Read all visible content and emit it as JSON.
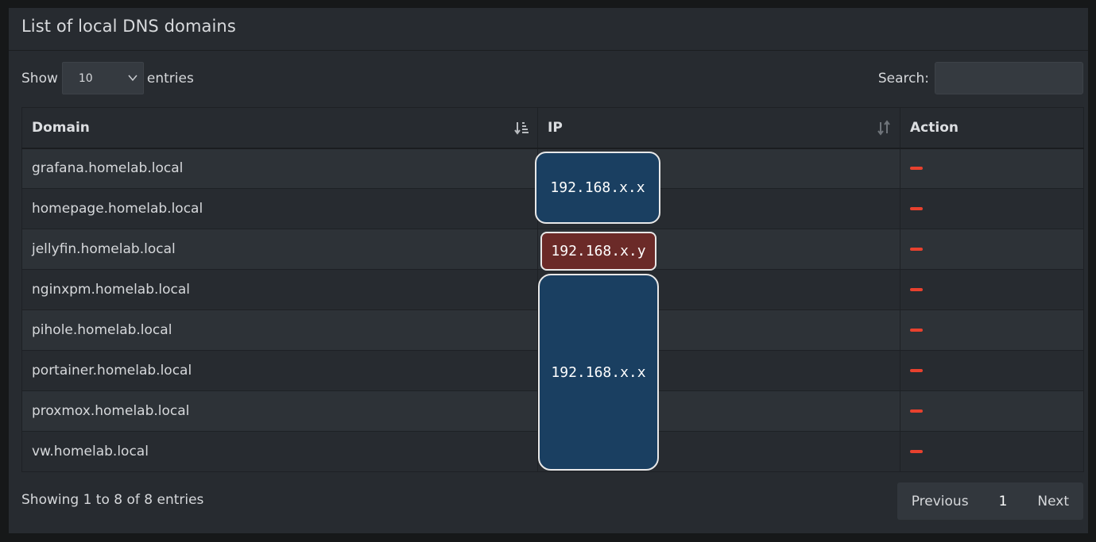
{
  "panel": {
    "title": "List of local DNS domains"
  },
  "length": {
    "show_label": "Show",
    "selected": "10",
    "entries_label": "entries"
  },
  "search": {
    "label": "Search:",
    "value": ""
  },
  "table": {
    "columns": [
      "Domain",
      "IP",
      "Action"
    ],
    "rows": [
      {
        "domain": "grafana.homelab.local"
      },
      {
        "domain": "homepage.homelab.local"
      },
      {
        "domain": "jellyfin.homelab.local"
      },
      {
        "domain": "nginxpm.homelab.local"
      },
      {
        "domain": "pihole.homelab.local"
      },
      {
        "domain": "portainer.homelab.local"
      },
      {
        "domain": "proxmox.homelab.local"
      },
      {
        "domain": "vw.homelab.local"
      }
    ]
  },
  "ip_annotations": [
    "192.168.x.x",
    "192.168.x.y",
    "192.168.x.x"
  ],
  "info": "Showing 1 to 8 of 8 entries",
  "pagination": {
    "previous": "Previous",
    "page": "1",
    "next": "Next"
  },
  "colors": {
    "remove_icon": "#e8412e",
    "badge_blue": "#1a3f61",
    "badge_red": "#6b2a28"
  }
}
